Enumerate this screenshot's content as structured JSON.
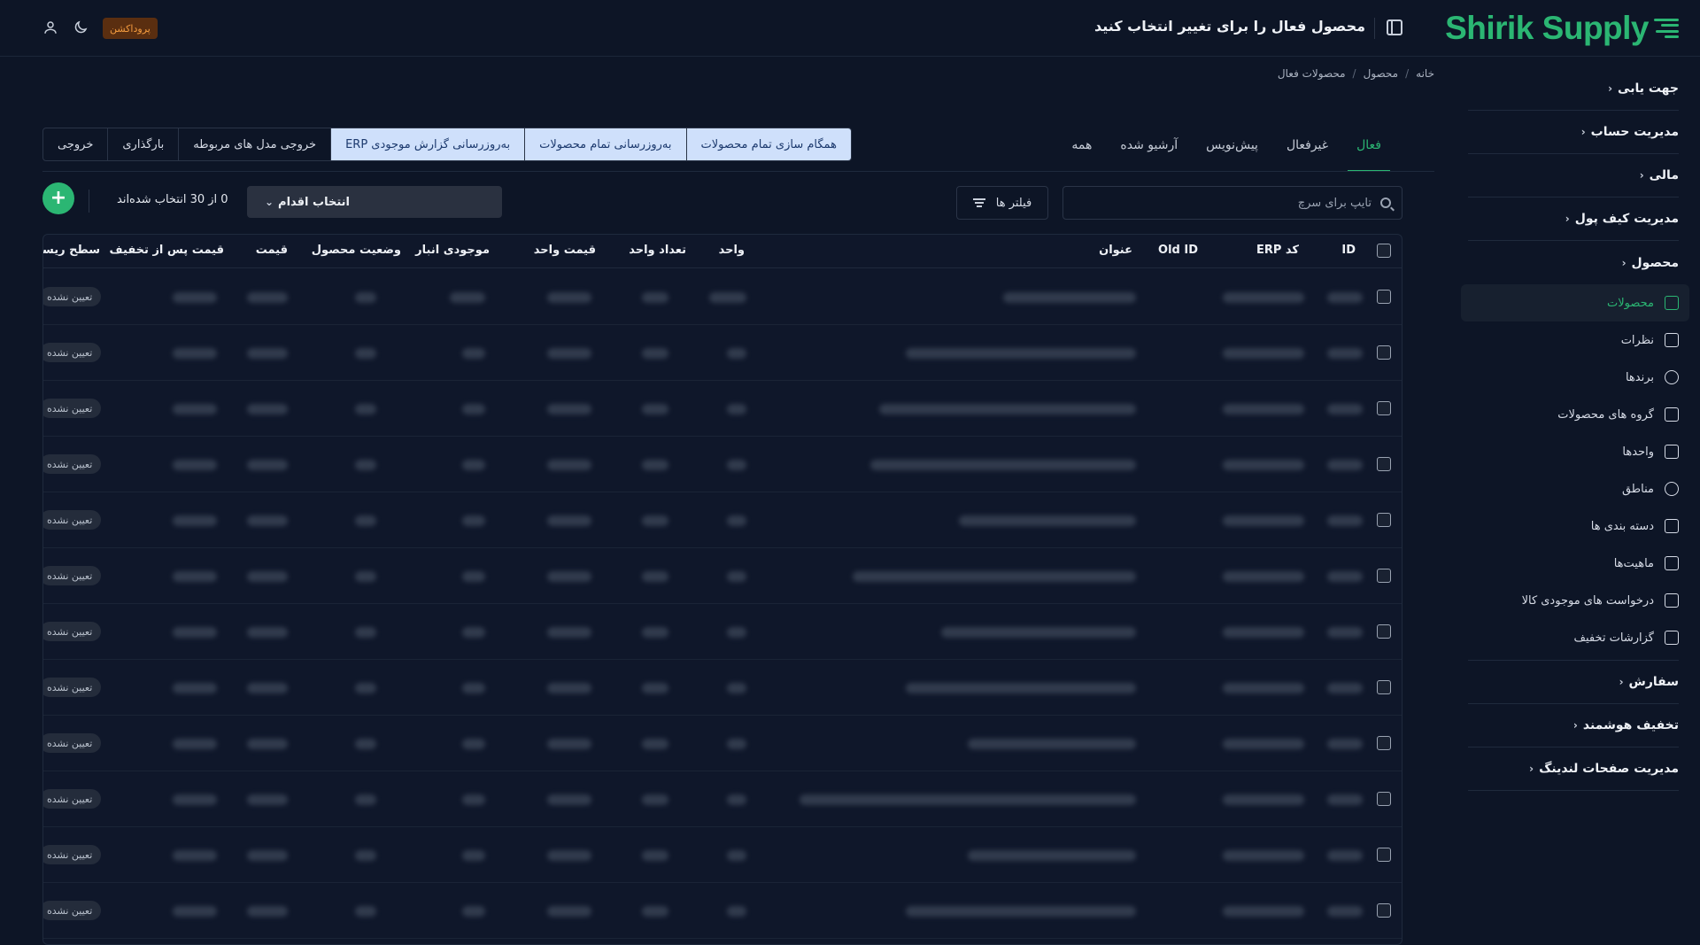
{
  "brand": {
    "name": "Shirik Supply",
    "color": "#2bb673"
  },
  "header": {
    "title": "محصول فعال را برای تغییر انتخاب کنید",
    "env_badge": "پروداکشن",
    "icons": [
      "sidebar-toggle-icon",
      "moon-icon",
      "user-icon"
    ]
  },
  "breadcrumb": [
    "خانه",
    "محصول",
    "محصولات فعال"
  ],
  "sidebar": {
    "groups_top": [
      {
        "label": "جهت یابی"
      },
      {
        "label": "مدیریت حساب"
      },
      {
        "label": "مالی"
      },
      {
        "label": "مدیریت کیف پول"
      }
    ],
    "open_group": "محصول",
    "items": [
      {
        "label": "محصولات",
        "icon": "products-icon",
        "active": true
      },
      {
        "label": "نظرات",
        "icon": "comments-icon"
      },
      {
        "label": "برندها",
        "icon": "badge-check-icon"
      },
      {
        "label": "گروه های محصولات",
        "icon": "copy-icon"
      },
      {
        "label": "واحدها",
        "icon": "cube-icon"
      },
      {
        "label": "مناطق",
        "icon": "map-pin-icon"
      },
      {
        "label": "دسته بندی ها",
        "icon": "list-icon"
      },
      {
        "label": "ماهیت‌ها",
        "icon": "file-settings-icon"
      },
      {
        "label": "درخواست های موجودی کالا",
        "icon": "copy-icon"
      },
      {
        "label": "گزارشات تخفیف",
        "icon": "tag-icon"
      }
    ],
    "groups_bottom": [
      {
        "label": "سفارش"
      },
      {
        "label": "تخفیف هوشمند"
      },
      {
        "label": "مدیریت صفحات لندینگ"
      }
    ]
  },
  "tabs": [
    "فعال",
    "غیرفعال",
    "پیش‌نویس",
    "آرشیو شده",
    "همه"
  ],
  "active_tab": "فعال",
  "action_buttons": [
    {
      "label": "همگام سازی تمام محصولات",
      "highlight": true
    },
    {
      "label": "به‌روزرسانی تمام محصولات",
      "highlight": true
    },
    {
      "label": "به‌روزرسانی گزارش موجودی ERP",
      "highlight": true
    },
    {
      "label": "خروجی مدل های مربوطه",
      "highlight": false
    },
    {
      "label": "بارگذاری",
      "highlight": false
    },
    {
      "label": "خروجی",
      "highlight": false
    }
  ],
  "toolbar": {
    "search_placeholder": "تایپ برای سرچ",
    "filters_label": "فیلتر ها",
    "action_select_label": "انتخاب اقدام",
    "selection_count": "0 از 30 انتخاب شده‌اند"
  },
  "table": {
    "columns": [
      "ID",
      "کد ERP",
      "Old ID",
      "عنوان",
      "واحد",
      "تعداد واحد",
      "قیمت واحد",
      "موجودی انبار",
      "وضعیت محصول",
      "قیمت",
      "قیمت پس از تخفیف",
      "سطح ریسک"
    ],
    "row_count_visible": 12,
    "risk_level_value": "تعیین نشده",
    "cells_blurred": true
  }
}
